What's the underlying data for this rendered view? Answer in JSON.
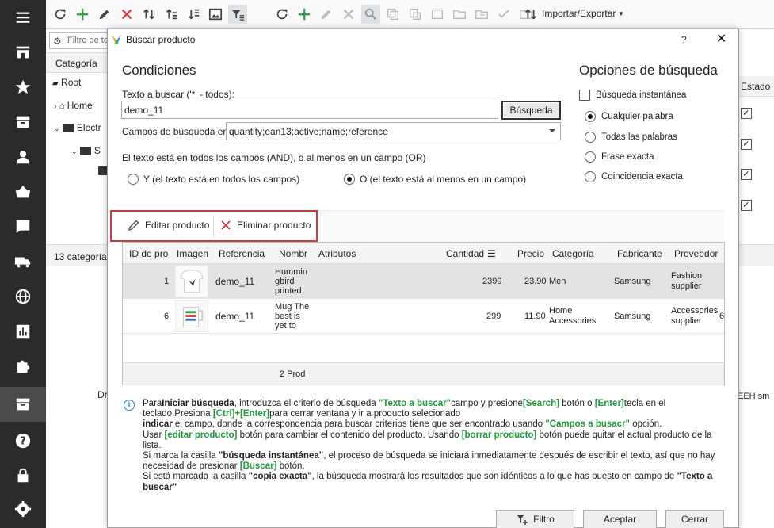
{
  "toolbar": {
    "import_export": "Importar/Exportar"
  },
  "background": {
    "filter_placeholder": "Filtro de te",
    "category_header": "Categoría",
    "tree": [
      "Root",
      "Home",
      "Electr",
      "S"
    ],
    "category_count": "13 categoría(",
    "dr_text": "Dr",
    "estado_header": "Estado",
    "right_text": "EEH sm"
  },
  "dialog": {
    "title": "Búscar producto",
    "help": "?",
    "close": "✕",
    "conditions_title": "Condiciones",
    "search_text_label": "Texto a buscar ('*' - todos):",
    "search_text_value": "demo_11",
    "search_button": "Búsqueda",
    "fields_label": "Campos de búsqueda en",
    "fields_value": "quantity;ean13;active;name;reference",
    "logic_text": "El texto está en todos los campos (AND), o al menos en un campo (OR)",
    "radio_and": "Y (el texto está en todos los campos)",
    "radio_or": "O (el texto está al menos en un campo)",
    "options_title": "Opciones de búsqueda",
    "instant_search": "Búsqueda instantánea",
    "opt_any": "Cualquier palabra",
    "opt_all": "Todas las palabras",
    "opt_phrase": "Frase exacta",
    "opt_exact": "Coincidencia exacta",
    "edit_product": "Editar producto",
    "delete_product": "Eliminar producto",
    "grid": {
      "columns": [
        "ID de pro",
        "Imagen",
        "Referencia",
        "Nombr",
        "Atributos",
        "Cantidad",
        "Precio",
        "Categoría",
        "Fabricante",
        "Proveedor"
      ],
      "rows": [
        {
          "id": "1",
          "ref": "demo_11",
          "name": [
            "Hummin",
            "gbird",
            "printed"
          ],
          "qty": "2399",
          "price": "23.90",
          "category": [
            "Men"
          ],
          "maker": "Samsung",
          "supplier": [
            "Fashion",
            "supplier"
          ],
          "extra": ""
        },
        {
          "id": "6",
          "ref": "demo_11",
          "name": [
            "Mug The",
            "best is",
            "yet to"
          ],
          "qty": "299",
          "price": "11.90",
          "category": [
            "Home",
            "Accessories"
          ],
          "maker": "Samsung",
          "supplier": [
            "Accessories",
            "supplier"
          ],
          "extra": "6"
        }
      ],
      "footer": "2 Prod"
    },
    "info": {
      "p1_a": "Para",
      "p1_b": "Iniciar búsqueda",
      "p1_c": ", introduzca el criterio de búsqueda ",
      "p1_d": "\"Texto a buscar\"",
      "p1_e": "campo y presione",
      "p1_f": "[Search]",
      "p1_g": " botón o ",
      "p1_h": "[Enter]",
      "p1_i": "tecla en el teclado.Presiona ",
      "p1_j": "[Ctrl]+[Enter]",
      "p1_k": "para cerrar ventana y ir a producto selecionado",
      "p2_a": "indicar",
      "p2_b": " el campo, donde la correspondencia para buscar criterios tiene que ser encontrado usando ",
      "p2_c": "\"Campos a busacr\"",
      "p2_d": " opción.",
      "p3_a": "Usar  ",
      "p3_b": "[editar producto]",
      "p3_c": " botón para cambiar el contenido del producto. Usando  ",
      "p3_d": "[borrar producto]",
      "p3_e": " botón puede quitar el actual producto de la lista.",
      "p4_a": "Si marca la casilla ",
      "p4_b": "\"búsqueda instantánea\"",
      "p4_c": ", el proceso de búsqueda se iniciará inmediatamente después de escribir el texto, así que no hay necesidad de presionar ",
      "p4_d": "[Buscar]",
      "p4_e": " botón.",
      "p5_a": "Si está marcada la casilla ",
      "p5_b": "\"copia exacta\"",
      "p5_c": ", la búsqueda mostrará los resultados que son idénticos a lo que has puesto en campo de ",
      "p5_d": "\"Texto a buscar\""
    },
    "btn_filter": "Filtro",
    "btn_accept": "Aceptar",
    "btn_close": "Cerrar"
  }
}
